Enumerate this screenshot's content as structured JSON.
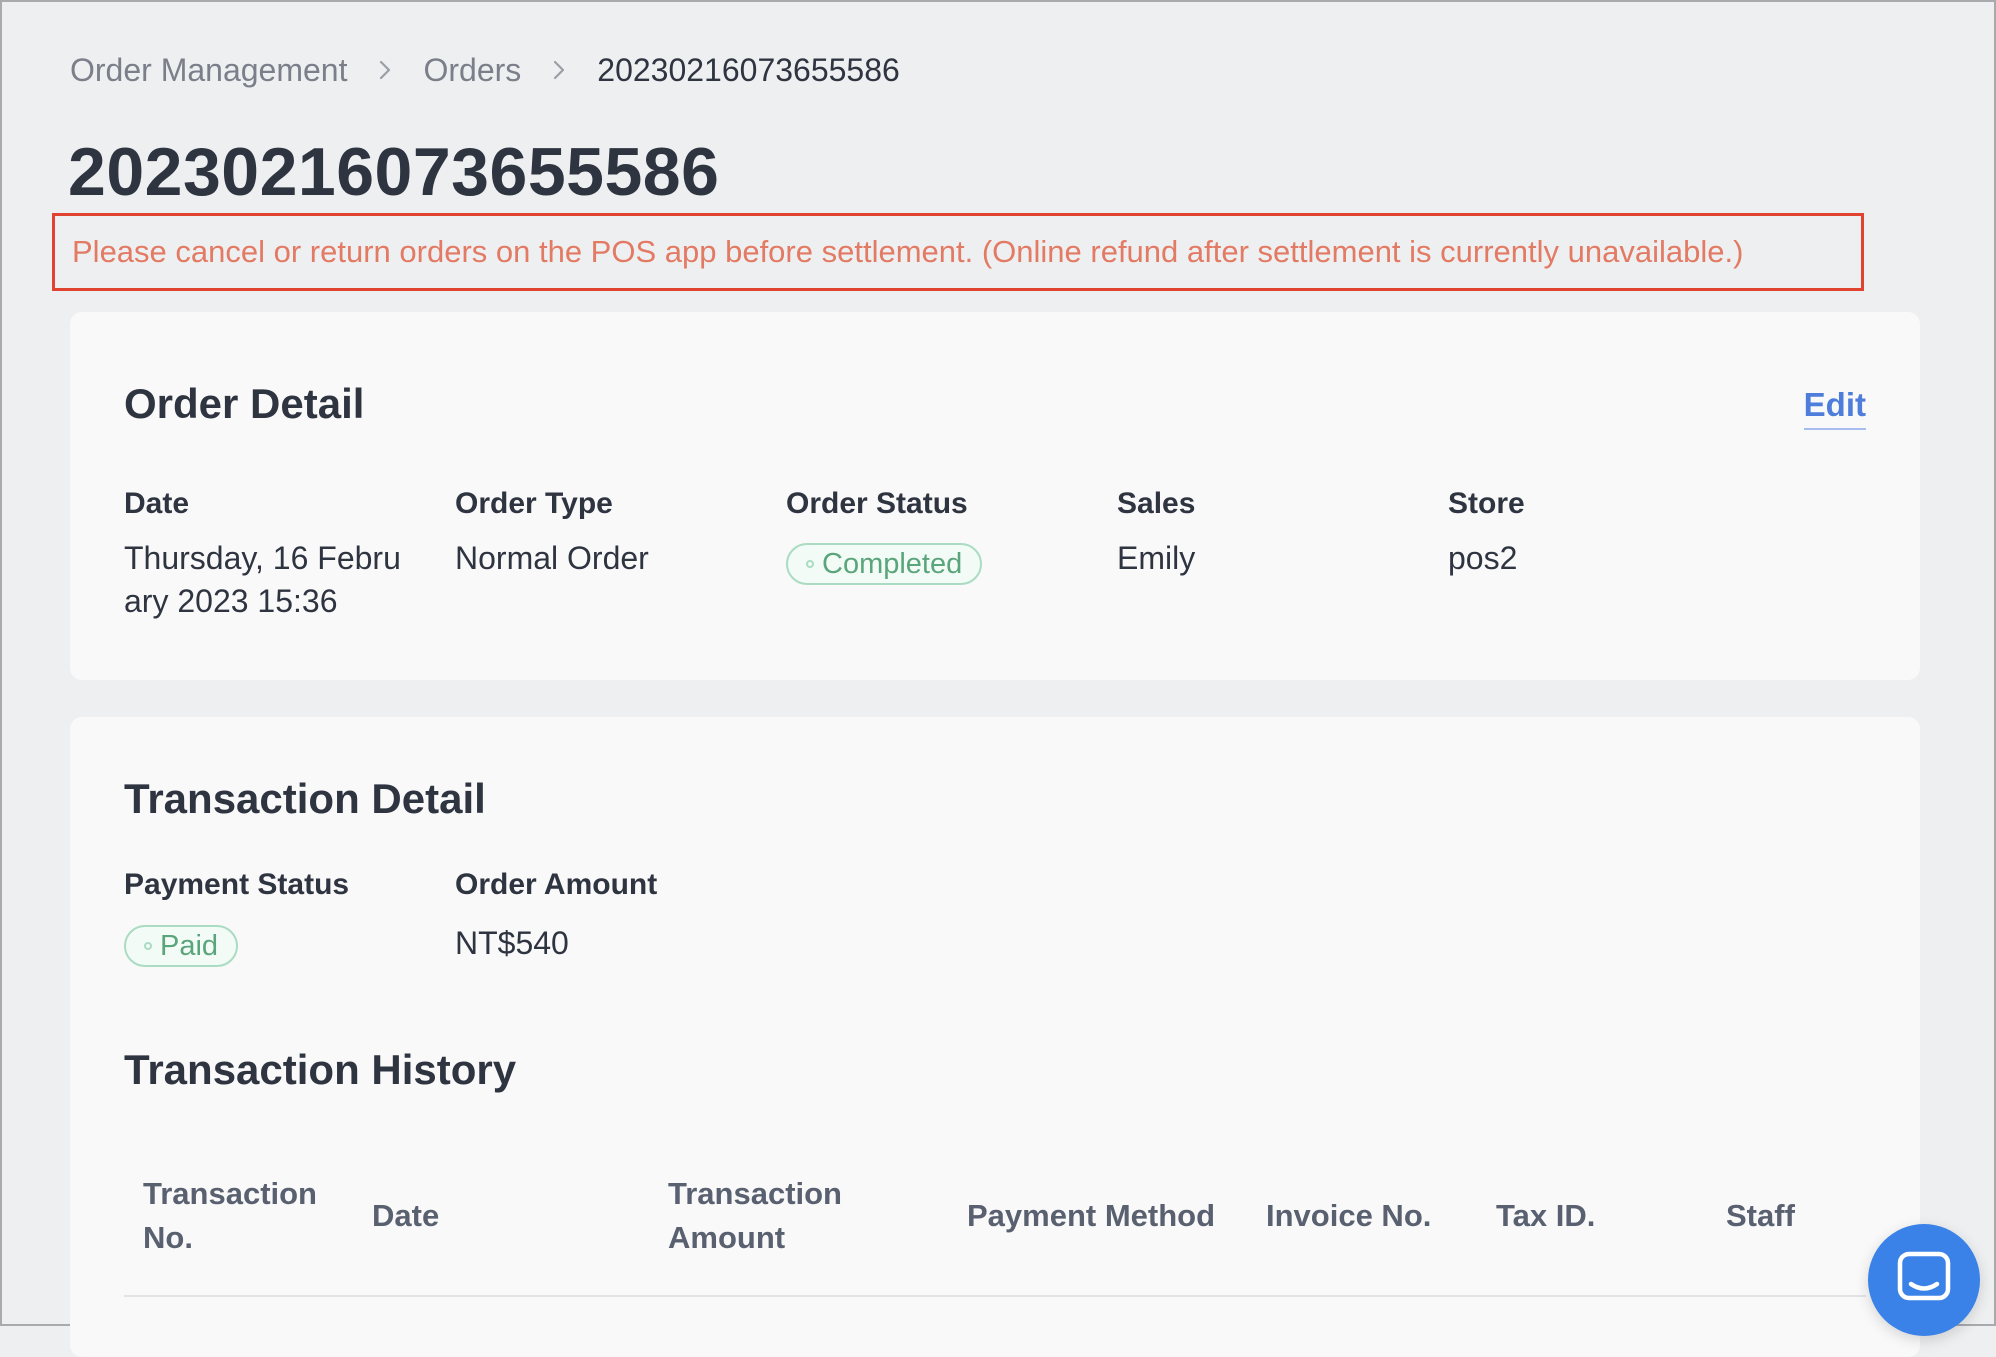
{
  "breadcrumb": {
    "items": [
      "Order Management",
      "Orders",
      "20230216073655586"
    ]
  },
  "page": {
    "title": "20230216073655586",
    "notice": "Please cancel or return orders on the POS app before settlement. (Online refund after settlement is currently unavailable.)"
  },
  "order_detail": {
    "title": "Order Detail",
    "edit_label": "Edit",
    "fields": [
      {
        "label": "Date",
        "value_line1": "Thursday, 16 Febru",
        "value_line2": "ary 2023 15:36"
      },
      {
        "label": "Order Type",
        "value": "Normal Order"
      },
      {
        "label": "Order Status",
        "badge": "Completed"
      },
      {
        "label": "Sales",
        "value": "Emily"
      },
      {
        "label": "Store",
        "value": "pos2"
      }
    ]
  },
  "transaction_detail": {
    "title": "Transaction Detail",
    "fields": [
      {
        "label": "Payment Status",
        "badge": "Paid"
      },
      {
        "label": "Order Amount",
        "value": "NT$540"
      }
    ]
  },
  "transaction_history": {
    "title": "Transaction History",
    "columns": [
      {
        "line1": "Transaction",
        "line2": "No."
      },
      {
        "line1": "Date"
      },
      {
        "line1": "Transaction",
        "line2": "Amount"
      },
      {
        "line1": "Payment Method"
      },
      {
        "line1": "Invoice No."
      },
      {
        "line1": "Tax ID."
      },
      {
        "line1": "Staff"
      }
    ]
  },
  "colors": {
    "accent": "#4f7ddc",
    "notice_border": "#e0432f",
    "notice_text": "#e37a63",
    "success": "#5aa57b",
    "chat": "#3b82e8"
  },
  "icons": {
    "breadcrumb_separator": "chevron-right-icon",
    "chat": "chat-bubble-icon"
  }
}
